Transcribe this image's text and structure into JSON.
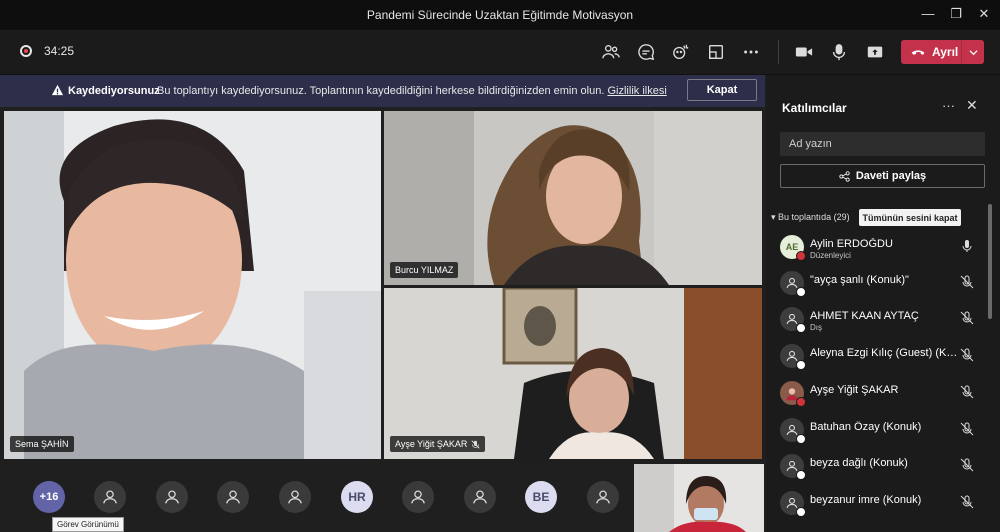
{
  "window": {
    "title": "Pandemi Sürecinde Uzaktan Eğitimde Motivasyon"
  },
  "toolbar": {
    "timer": "34:25",
    "leave_label": "Ayrıl"
  },
  "banner": {
    "title": "Kaydediyorsunuz",
    "message": "Bu toplantıyı kaydediyorsunuz. Toplantının kaydedildiğini herkese bildirdiğinizden emin olun.",
    "link": "Gizlilik ilkesi",
    "close_label": "Kapat"
  },
  "videos": {
    "main": {
      "name": "Sema ŞAHİN"
    },
    "top_right": {
      "name": "Burcu YILMAZ"
    },
    "bottom_right": {
      "name": "Ayşe Yiğit ŞAKAR",
      "muted": true
    }
  },
  "bottom": {
    "overflow": "+16",
    "initials": [
      "HR",
      "BE"
    ],
    "tooltip": "Görev Görünümü"
  },
  "panel": {
    "title": "Katılımcılar",
    "search_placeholder": "Ad yazın",
    "share_label": "Daveti paylaş",
    "section_label": "Bu toplantıda (29)",
    "mute_all_label": "Tümünün sesini kapat",
    "participants": [
      {
        "name": "Aylin ERDOĞDU",
        "sub": "Düzenleyici",
        "initials": "AE",
        "mic": "on"
      },
      {
        "name": "\"ayça şanlı (Konuk)\"",
        "sub": "",
        "mic": "off"
      },
      {
        "name": "AHMET KAAN AYTAÇ",
        "sub": "Dış",
        "mic": "off"
      },
      {
        "name": "Aleyna Ezgi Kılıç (Guest) (Kon...",
        "sub": "",
        "mic": "off"
      },
      {
        "name": "Ayşe Yiğit ŞAKAR",
        "sub": "",
        "mic": "off"
      },
      {
        "name": "Batuhan Özay (Konuk)",
        "sub": "",
        "mic": "off"
      },
      {
        "name": "beyza dağlı (Konuk)",
        "sub": "",
        "mic": "off"
      },
      {
        "name": "beyzanur imre (Konuk)",
        "sub": "",
        "mic": "off"
      }
    ]
  },
  "colors": {
    "leave": "#c4314b",
    "banner": "#2d2f4a",
    "accent": "#6264a7"
  }
}
